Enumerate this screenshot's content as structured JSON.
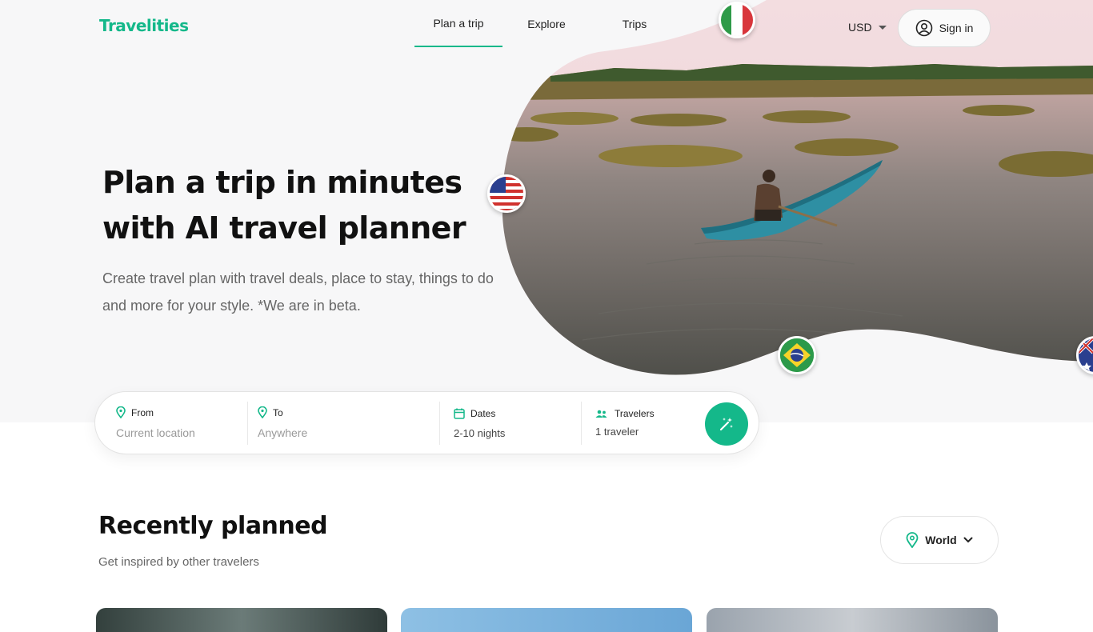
{
  "header": {
    "logo": "Travelities",
    "nav": [
      "Plan a trip",
      "Explore",
      "Trips"
    ],
    "currency": "USD",
    "signin_label": "Sign in"
  },
  "hero": {
    "title_line1": "Plan a trip in minutes",
    "title_line2": "with AI travel planner",
    "subtitle": "Create travel plan with travel deals, place to stay, things to do and more for your style. *We are in beta."
  },
  "search": {
    "from": {
      "label": "From",
      "placeholder": "Current location"
    },
    "to": {
      "label": "To",
      "placeholder": "Anywhere"
    },
    "dates": {
      "label": "Dates",
      "value": "2-10 nights"
    },
    "travelers": {
      "label": "Travelers",
      "value": "1 traveler"
    }
  },
  "recent": {
    "title": "Recently planned",
    "subtitle": "Get inspired by other travelers",
    "filter": "World"
  },
  "colors": {
    "accent": "#14b88a",
    "hero_bg": "#f7f7f8"
  },
  "icons": [
    "pin-icon",
    "calendar-icon",
    "people-icon",
    "magic-wand-icon",
    "user-icon",
    "chevron-down-icon"
  ]
}
